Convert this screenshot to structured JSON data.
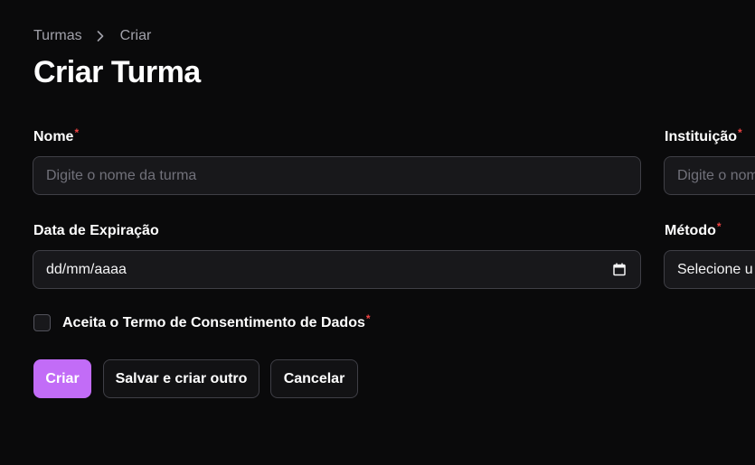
{
  "breadcrumb": {
    "items": [
      "Turmas",
      "Criar"
    ]
  },
  "page": {
    "title": "Criar Turma"
  },
  "form": {
    "nome": {
      "label": "Nome",
      "required_mark": "*",
      "placeholder": "Digite o nome da turma",
      "value": ""
    },
    "instituicao": {
      "label": "Instituição",
      "required_mark": "*",
      "placeholder": "Digite o nom"
    },
    "data_expiracao": {
      "label": "Data de Expiração",
      "value": "dd/mm/aaaa"
    },
    "metodo": {
      "label": "Método",
      "required_mark": "*",
      "value": "Selecione u"
    },
    "consentimento": {
      "label": "Aceita o Termo de Consentimento de Dados",
      "required_mark": "*",
      "checked": false
    }
  },
  "actions": {
    "create": "Criar",
    "save_and_create_another": "Salvar e criar outro",
    "cancel": "Cancelar"
  },
  "colors": {
    "background": "#0a0a0b",
    "input_bg": "#18181b",
    "border": "#3f3f46",
    "primary": "#c26cf7",
    "required": "#ef4444"
  },
  "icons": {
    "breadcrumb_separator": "chevron-right-icon",
    "date_picker": "calendar-icon"
  }
}
